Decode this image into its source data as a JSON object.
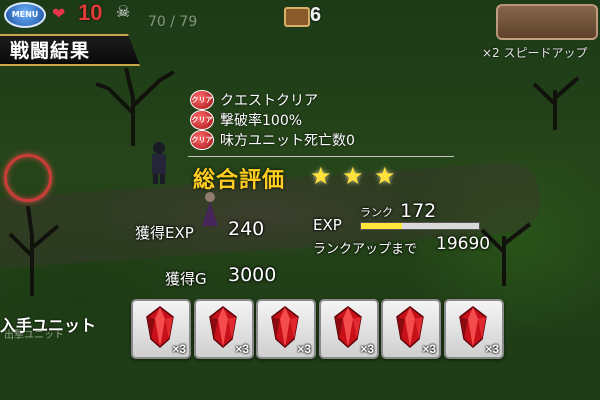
{
  "hud": {
    "menu_label": "MENU",
    "life_value": "10",
    "enemy_counter": "70 / 79",
    "gate_value": "6",
    "speed_label": "×2 スピードアップ"
  },
  "result": {
    "title": "戦闘結果",
    "badge_label": "クリア",
    "conditions": [
      "クエストクリア",
      "撃破率100%",
      "味方ユニット死亡数0"
    ],
    "overall_label": "総合評価",
    "stars": 3,
    "exp_label": "獲得EXP",
    "exp_value": "240",
    "gold_label": "獲得G",
    "gold_value": "3000",
    "rank_exp_label": "EXP",
    "rank_label": "ランク",
    "rank_value": "172",
    "rank_progress": 0.35,
    "rank_up_label": "ランクアップまで",
    "rank_up_value": "19690"
  },
  "units": {
    "label": "入手ユニット",
    "behind_text": "出撃ユニット",
    "items": [
      {
        "icon": "red-crystal-icon",
        "count": "×3"
      },
      {
        "icon": "red-crystal-icon",
        "count": "×3"
      },
      {
        "icon": "red-crystal-icon",
        "count": "×3"
      },
      {
        "icon": "red-crystal-icon",
        "count": "×3"
      },
      {
        "icon": "red-crystal-icon",
        "count": "×3"
      },
      {
        "icon": "red-crystal-icon",
        "count": "×3"
      }
    ]
  },
  "colors": {
    "rating_gold": "#ffcd22",
    "star": "#ffe23a",
    "badge_red": "#c4161c",
    "exp_fill": "#ffe83a",
    "banner_trim": "#c9a64a"
  }
}
